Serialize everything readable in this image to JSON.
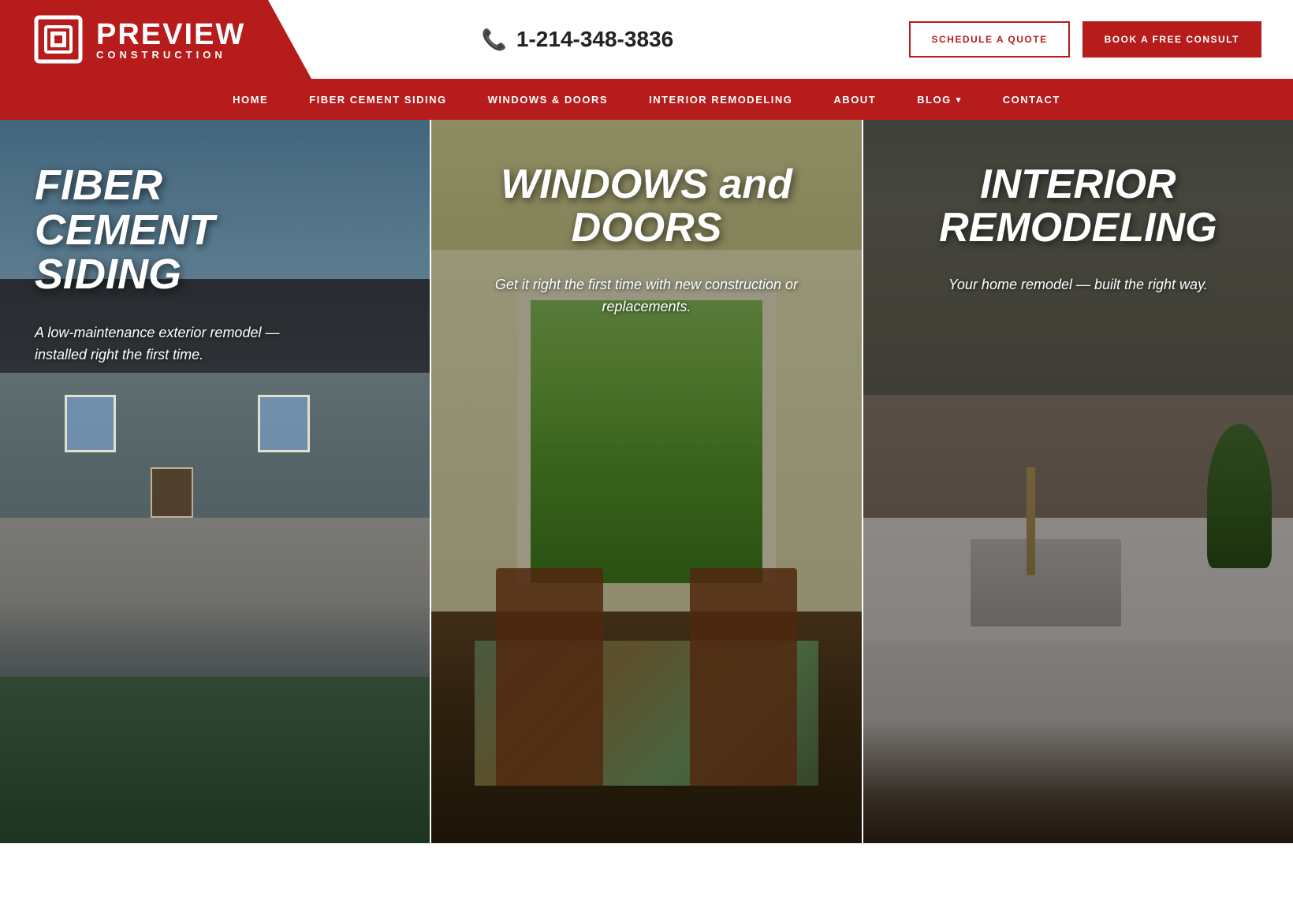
{
  "brand": {
    "name_line1": "PREVIEW",
    "name_line2": "CONSTRUCTION"
  },
  "header": {
    "phone_display": "1-214-348-3836",
    "btn_quote": "SCHEDULE A QUOTE",
    "btn_consult": "BOOK A FREE CONSULT"
  },
  "nav": {
    "items": [
      {
        "label": "HOME",
        "has_dropdown": false
      },
      {
        "label": "FIBER CEMENT SIDING",
        "has_dropdown": false
      },
      {
        "label": "WINDOWS & DOORS",
        "has_dropdown": false
      },
      {
        "label": "INTERIOR REMODELING",
        "has_dropdown": false
      },
      {
        "label": "ABOUT",
        "has_dropdown": false
      },
      {
        "label": "BLOG",
        "has_dropdown": true
      },
      {
        "label": "CONTACT",
        "has_dropdown": false
      }
    ]
  },
  "hero": {
    "panels": [
      {
        "title": "FIBER CEMENT SIDING",
        "subtitle": "A low-maintenance exterior remodel — installed right the first time.",
        "bg_class": "bg-siding"
      },
      {
        "title": "WINDOWS and DOORS",
        "subtitle": "Get it right the first time with new construction or replacements.",
        "bg_class": "bg-windows"
      },
      {
        "title": "INTERIOR REMODELING",
        "subtitle": "Your home remodel — built the right way.",
        "bg_class": "bg-interior"
      }
    ]
  }
}
